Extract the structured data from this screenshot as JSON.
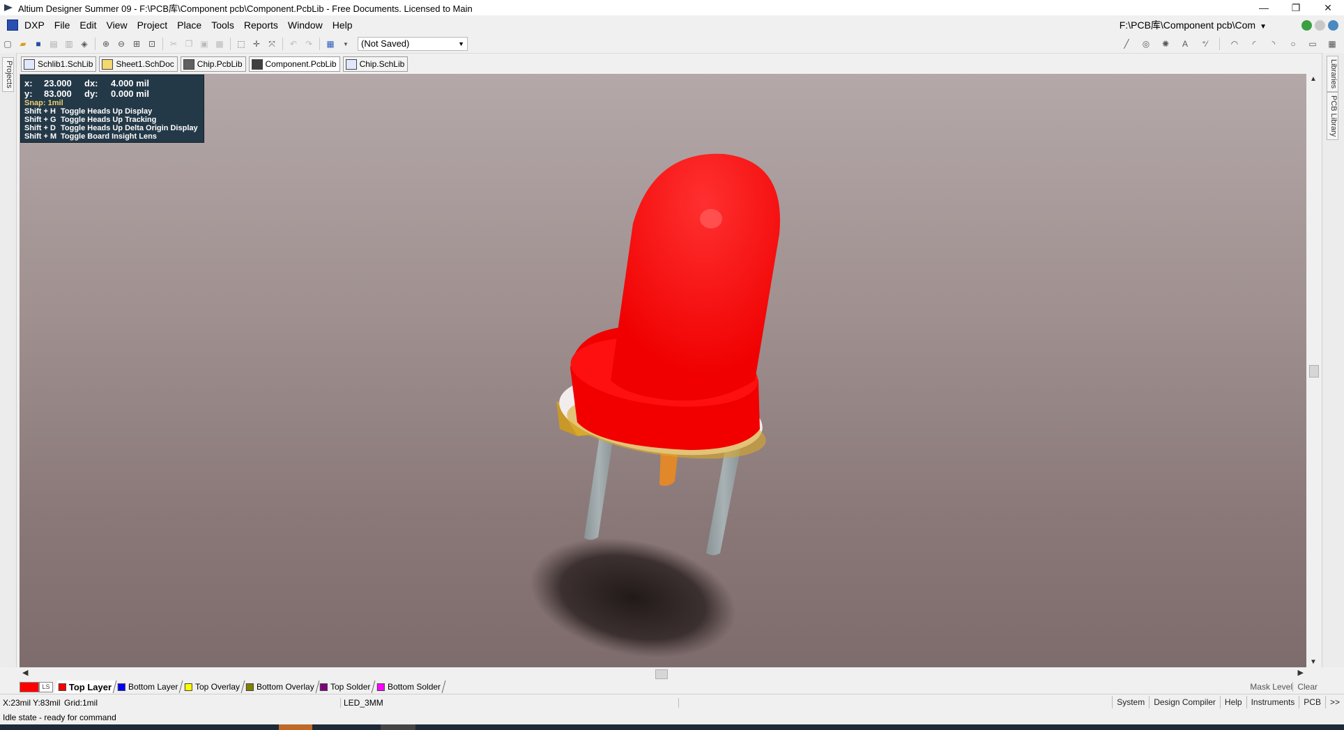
{
  "window": {
    "title": "Altium Designer Summer 09 - F:\\PCB库\\Component pcb\\Component.PcbLib - Free Documents. Licensed to Main",
    "minimize": "—",
    "restore": "❐",
    "close": "✕"
  },
  "menu": {
    "dxp": "DXP",
    "items": [
      "File",
      "Edit",
      "View",
      "Project",
      "Place",
      "Tools",
      "Reports",
      "Window",
      "Help"
    ],
    "path": "F:\\PCB库\\Component pcb\\Com"
  },
  "toolbar": {
    "saved_state": "(Not Saved)"
  },
  "doc_tabs": [
    "Schlib1.SchLib",
    "Sheet1.SchDoc",
    "Chip.PcbLib",
    "Component.PcbLib",
    "Chip.SchLib"
  ],
  "left_panel": {
    "projects_tab": "Projects"
  },
  "right_panel": {
    "libraries_tab": "Libraries",
    "pcb_library_tab": "PCB Library"
  },
  "hud": {
    "x_label": "x:",
    "x_val": "23.000",
    "dx_label": "dx:",
    "dx_val": "4.000 mil",
    "y_label": "y:",
    "y_val": "83.000",
    "dy_label": "dy:",
    "dy_val": "0.000 mil",
    "snap": "Snap: 1mil",
    "shortcuts": [
      {
        "key": "Shift + H",
        "text": "Toggle Heads Up Display"
      },
      {
        "key": "Shift + G",
        "text": "Toggle Heads Up Tracking"
      },
      {
        "key": "Shift + D",
        "text": "Toggle Heads Up Delta Origin Display"
      },
      {
        "key": "Shift + M",
        "text": "Toggle Board Insight Lens"
      }
    ]
  },
  "layers": {
    "ls": "LS",
    "tabs": [
      {
        "name": "Top Layer",
        "color": "#ff0000",
        "active": true
      },
      {
        "name": "Bottom Layer",
        "color": "#0000ff"
      },
      {
        "name": "Top Overlay",
        "color": "#ffff00"
      },
      {
        "name": "Bottom Overlay",
        "color": "#808000"
      },
      {
        "name": "Top Solder",
        "color": "#800080"
      },
      {
        "name": "Bottom Solder",
        "color": "#ff00ff"
      }
    ],
    "mask_level": "Mask Level",
    "clear": "Clear"
  },
  "status": {
    "coords": "X:23mil Y:83mil",
    "grid": "Grid:1mil",
    "component": "LED_3MM",
    "message": "Idle state - ready for command",
    "buttons": [
      "System",
      "Design Compiler",
      "Help",
      "Instruments",
      "PCB",
      ">>"
    ]
  },
  "model": {
    "led_color": "#ff0000",
    "pin_color": "#9aa4a6"
  }
}
